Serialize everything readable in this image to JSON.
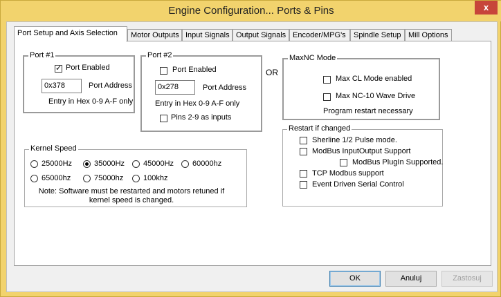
{
  "window": {
    "title": "Engine Configuration... Ports & Pins",
    "close_glyph": "x"
  },
  "tabs": [
    {
      "label": "Port Setup and Axis Selection",
      "active": true
    },
    {
      "label": "Motor Outputs"
    },
    {
      "label": "Input Signals"
    },
    {
      "label": "Output Signals"
    },
    {
      "label": "Encoder/MPG's"
    },
    {
      "label": "Spindle Setup"
    },
    {
      "label": "Mill Options"
    }
  ],
  "port1": {
    "title": "Port #1",
    "enabled_label": "Port Enabled",
    "enabled": true,
    "address": "0x378",
    "address_label": "Port Address",
    "hint": "Entry in Hex 0-9 A-F only"
  },
  "port2": {
    "title": "Port #2",
    "enabled_label": "Port Enabled",
    "enabled": false,
    "address": "0x278",
    "address_label": "Port Address",
    "hint": "Entry in Hex 0-9 A-F only",
    "pins_label": "Pins 2-9 as inputs",
    "pins_checked": false
  },
  "or_label": "OR",
  "maxnc": {
    "title": "MaxNC Mode",
    "cl_label": "Max CL Mode enabled",
    "nc10_label": "Max NC-10 Wave Drive",
    "note": "Program restart necessary"
  },
  "kernel": {
    "title": "Kernel Speed",
    "options": [
      "25000Hz",
      "35000Hz",
      "45000Hz",
      "60000hz",
      "65000hz",
      "75000hz",
      "100khz"
    ],
    "selected": "35000Hz",
    "note": "Note: Software must be restarted and motors retuned if kernel speed is changed."
  },
  "restart": {
    "title": "Restart if changed",
    "items": [
      {
        "label": "Sherline 1/2 Pulse mode.",
        "checked": false
      },
      {
        "label": "ModBus InputOutput Support",
        "checked": false
      },
      {
        "label": "ModBus PlugIn Supported.",
        "checked": false
      },
      {
        "label": "TCP Modbus support",
        "checked": false
      },
      {
        "label": "Event Driven Serial Control",
        "checked": false
      }
    ]
  },
  "buttons": {
    "ok": "OK",
    "cancel": "Anuluj",
    "apply": "Zastosuj"
  },
  "colors": {
    "titlebar": "#f2d36d",
    "close": "#c7453a",
    "panel": "#ffffff",
    "dialog": "#f0f0f0"
  }
}
